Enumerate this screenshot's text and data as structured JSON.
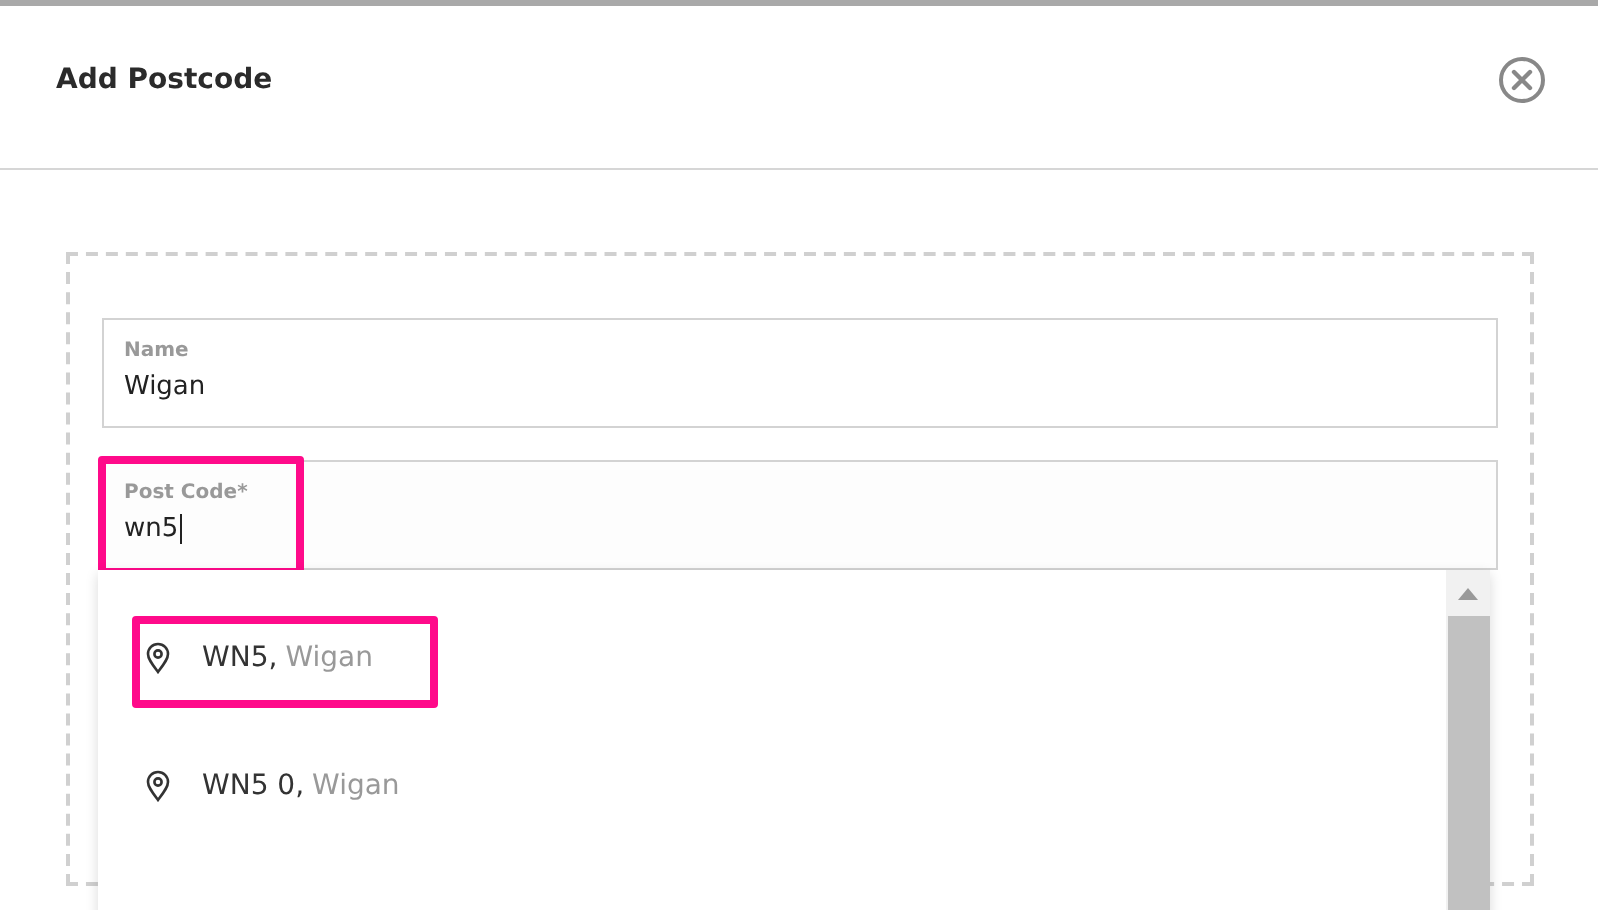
{
  "dialog": {
    "title": "Add Postcode"
  },
  "fields": [
    {
      "label": "Name",
      "value": "Wigan",
      "highlighted": false,
      "focused": false
    },
    {
      "label": "Post Code*",
      "value": "wn5",
      "highlighted": true,
      "focused": true
    }
  ],
  "suggestions": [
    {
      "code": "WN5,",
      "place": "Wigan",
      "highlighted": true
    },
    {
      "code": "WN5 0,",
      "place": "Wigan",
      "highlighted": false
    }
  ]
}
